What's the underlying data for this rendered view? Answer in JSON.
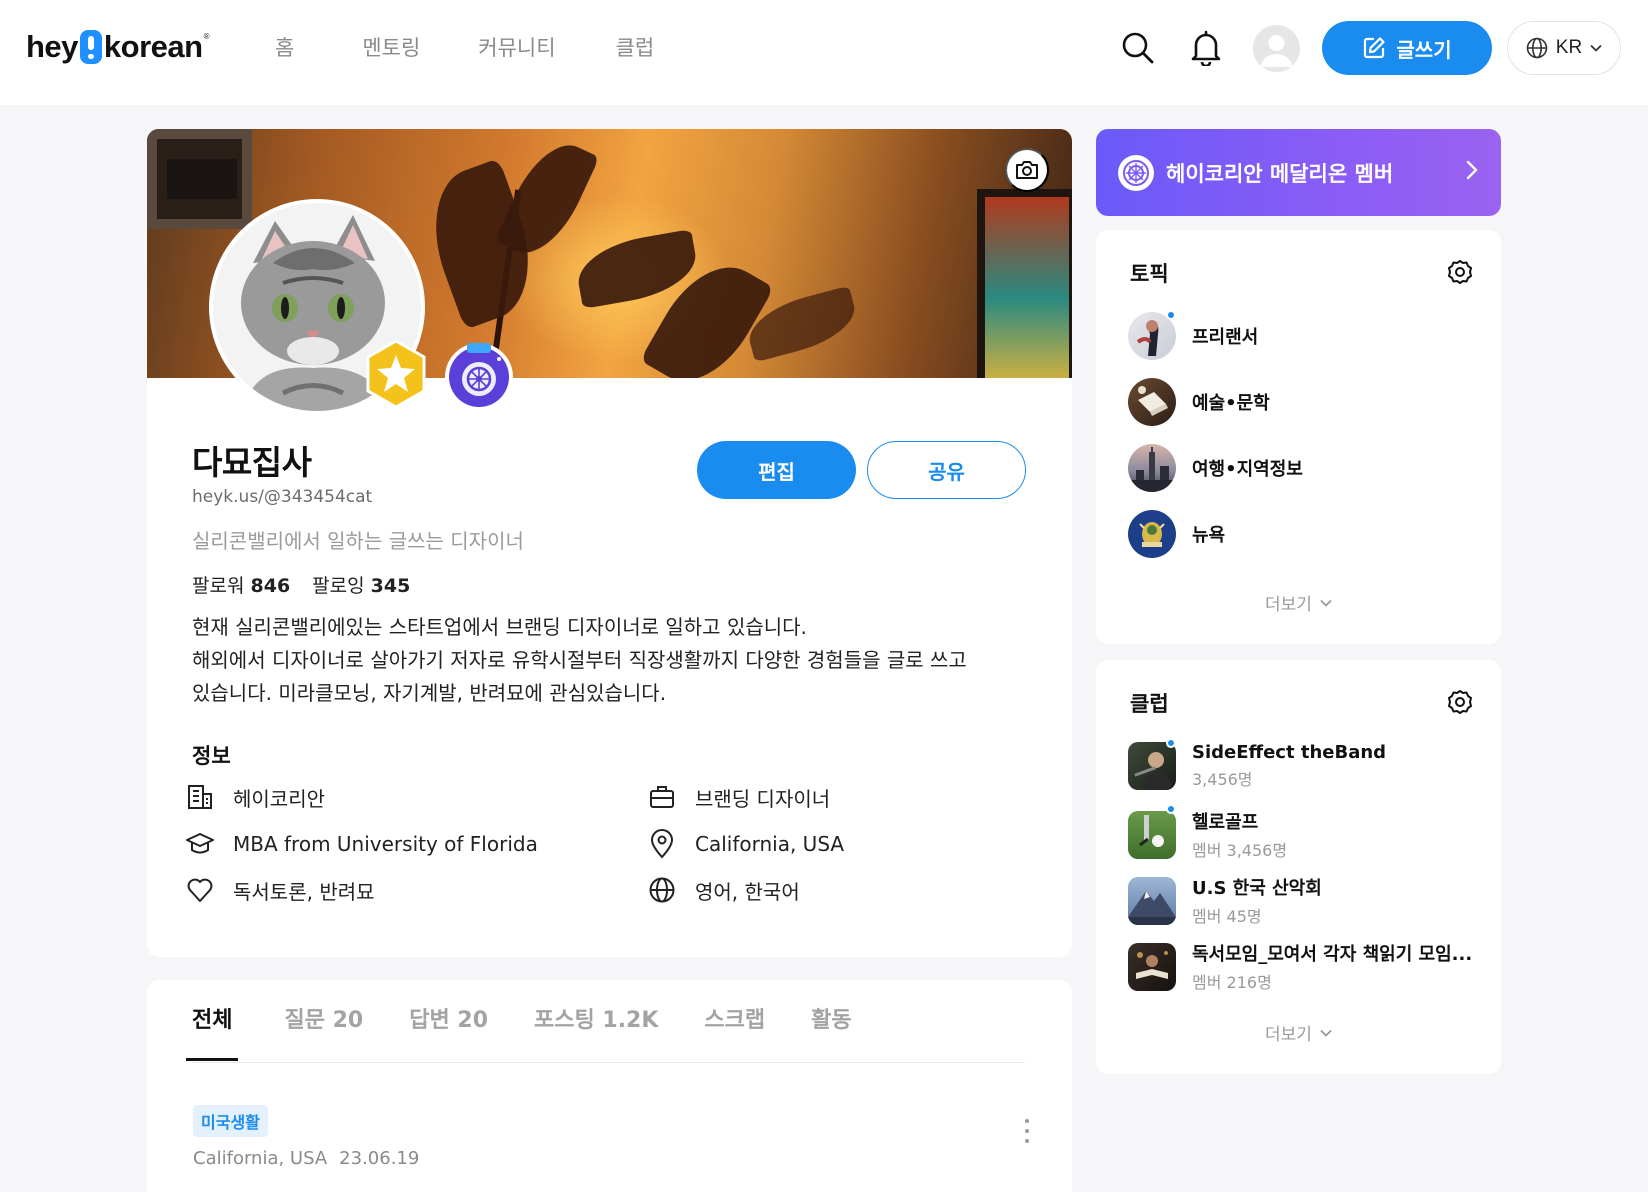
{
  "header": {
    "logo_text_left": "hey",
    "logo_text_right": "korean",
    "logo_mark": "®",
    "nav": [
      "홈",
      "멘토링",
      "커뮤니티",
      "클럽"
    ],
    "write_label": "글쓰기",
    "lang_label": "KR"
  },
  "profile": {
    "name": "다묘집사",
    "url": "heyk.us/@343454cat",
    "tagline": "실리콘밸리에서 일하는 글쓰는 디자이너",
    "followers_label": "팔로워",
    "followers_count": "846",
    "following_label": "팔로잉",
    "following_count": "345",
    "bio_lines": [
      "현재 실리콘밸리에있는 스타트업에서 브랜딩 디자이너로 일하고 있습니다.",
      "해외에서 디자이너로 살아가기 저자로 유학시절부터 직장생활까지 다양한 경험들을 글로 쓰고",
      "있습니다. 미라클모닝, 자기계발, 반려묘에 관심있습니다."
    ],
    "edit_label": "편집",
    "share_label": "공유"
  },
  "info": {
    "title": "정보",
    "items": [
      {
        "icon": "building-icon",
        "text": "헤이코리안"
      },
      {
        "icon": "briefcase-icon",
        "text": "브랜딩 디자이너"
      },
      {
        "icon": "graduation-cap-icon",
        "text": "MBA from University of Florida"
      },
      {
        "icon": "location-pin-icon",
        "text": "California, USA"
      },
      {
        "icon": "heart-icon",
        "text": "독서토론, 반려묘"
      },
      {
        "icon": "globe-icon",
        "text": "영어, 한국어"
      }
    ]
  },
  "tabs": [
    "전체",
    "질문 20",
    "답변 20",
    "포스팅 1.2K",
    "스크랩",
    "활동"
  ],
  "post": {
    "tag": "미국생활",
    "location": "California, USA",
    "date": "23.06.19"
  },
  "medalion": {
    "label": "헤이코리안 메달리온 멤버"
  },
  "topics": {
    "title": "토픽",
    "items": [
      "프리랜서",
      "예술•문학",
      "여행•지역정보",
      "뉴욕"
    ],
    "more_label": "더보기"
  },
  "clubs": {
    "title": "클럽",
    "items": [
      {
        "name": "SideEffect theBand",
        "sub": "3,456명"
      },
      {
        "name": "헬로골프",
        "sub": "멤버 3,456명"
      },
      {
        "name": "U.S 한국 산악회",
        "sub": "멤버 45명"
      },
      {
        "name": "독서모임_모여서 각자 책읽기 모임...",
        "sub": "멤버 216명"
      }
    ],
    "more_label": "더보기"
  },
  "colors": {
    "accent": "#1a8cf0",
    "medalion_start": "#6a5af9",
    "medalion_end": "#9a63f0",
    "tag_bg": "#e4f1fd"
  }
}
